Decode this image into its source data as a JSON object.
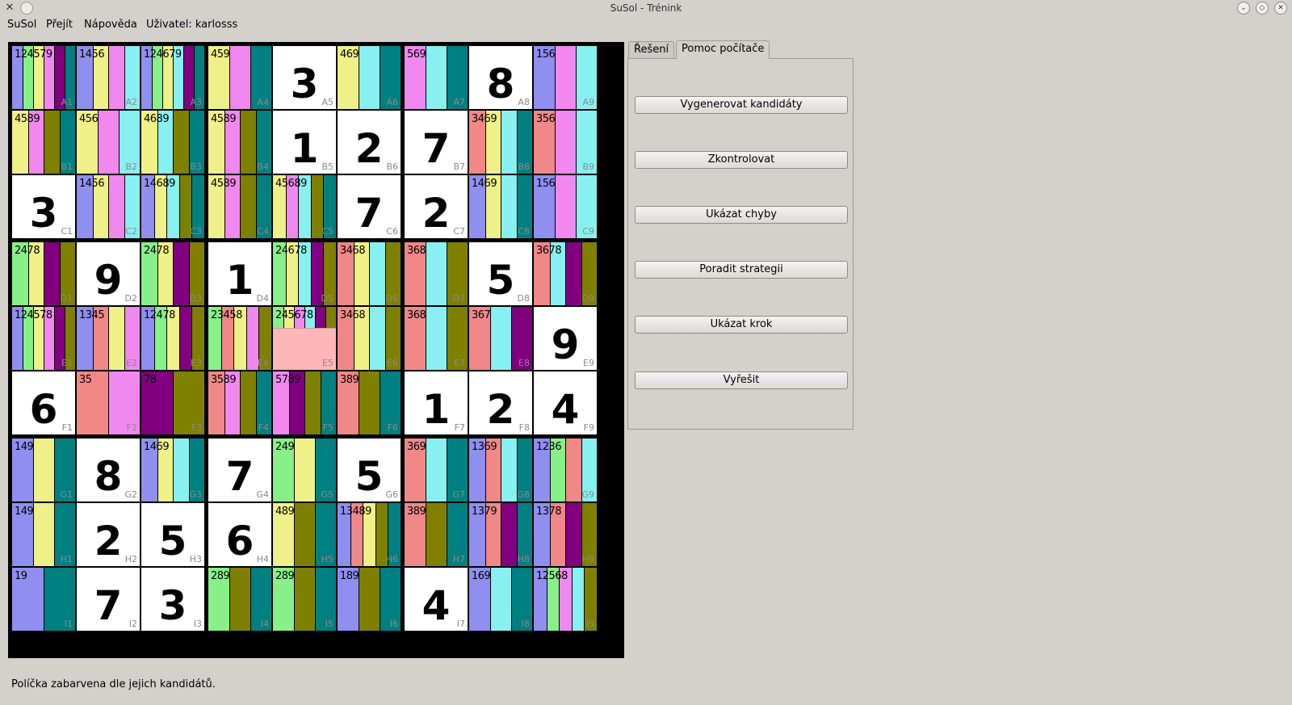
{
  "window": {
    "title": "SuSol - Trénink"
  },
  "menu": [
    "SuSol",
    "Přejít",
    "Nápověda",
    "Uživatel: karlosss"
  ],
  "tabs": [
    "Řešení",
    "Pomoc počítače"
  ],
  "buttons": [
    "Vygenerovat kandidáty",
    "Zkontrolovat",
    "Ukázat chyby",
    "Poradit strategii",
    "Ukázat krok",
    "Vyřešit"
  ],
  "status": "Políčka zabarvena dle jejich kandidátů.",
  "candidate_colors": {
    "1": "#8f8ff0",
    "2": "#88f088",
    "3": "#f08888",
    "4": "#f0f088",
    "5": "#f088f0",
    "6": "#88f0f0",
    "7": "#800080",
    "8": "#808000",
    "9": "#008080"
  },
  "rows": [
    "A",
    "B",
    "C",
    "D",
    "E",
    "F",
    "G",
    "H",
    "I"
  ],
  "grid": [
    [
      {
        "c": "124579"
      },
      {
        "c": "1456"
      },
      {
        "c": "124679"
      },
      {
        "c": "459"
      },
      {
        "v": "3"
      },
      {
        "c": "469"
      },
      {
        "c": "569"
      },
      {
        "v": "8"
      },
      {
        "c": "156"
      }
    ],
    [
      {
        "c": "4589"
      },
      {
        "c": "456"
      },
      {
        "c": "4689"
      },
      {
        "c": "4589"
      },
      {
        "v": "1"
      },
      {
        "v": "2"
      },
      {
        "v": "7"
      },
      {
        "c": "3469"
      },
      {
        "c": "356"
      }
    ],
    [
      {
        "v": "3"
      },
      {
        "c": "1456"
      },
      {
        "c": "14689"
      },
      {
        "c": "4589"
      },
      {
        "c": "45689"
      },
      {
        "v": "7"
      },
      {
        "v": "2"
      },
      {
        "c": "1469"
      },
      {
        "c": "156"
      }
    ],
    [
      {
        "c": "2478"
      },
      {
        "v": "9"
      },
      {
        "c": "2478"
      },
      {
        "v": "1"
      },
      {
        "c": "24678"
      },
      {
        "c": "3468"
      },
      {
        "c": "368"
      },
      {
        "v": "5"
      },
      {
        "c": "3678"
      }
    ],
    [
      {
        "c": "124578"
      },
      {
        "c": "1345"
      },
      {
        "c": "12478"
      },
      {
        "c": "23458"
      },
      {
        "c": "245678",
        "blank": true
      },
      {
        "c": "3468"
      },
      {
        "c": "368"
      },
      {
        "c": "367"
      },
      {
        "v": "9"
      }
    ],
    [
      {
        "v": "6"
      },
      {
        "c": "35"
      },
      {
        "c": "78"
      },
      {
        "c": "3589"
      },
      {
        "c": "5789"
      },
      {
        "c": "389"
      },
      {
        "v": "1"
      },
      {
        "v": "2"
      },
      {
        "v": "4"
      }
    ],
    [
      {
        "c": "149"
      },
      {
        "v": "8"
      },
      {
        "c": "1469"
      },
      {
        "v": "7"
      },
      {
        "c": "249"
      },
      {
        "v": "5"
      },
      {
        "c": "369"
      },
      {
        "c": "1369"
      },
      {
        "c": "1236"
      }
    ],
    [
      {
        "c": "149"
      },
      {
        "v": "2"
      },
      {
        "v": "5"
      },
      {
        "v": "6"
      },
      {
        "c": "489"
      },
      {
        "c": "13489"
      },
      {
        "c": "389"
      },
      {
        "c": "1379"
      },
      {
        "c": "1378"
      }
    ],
    [
      {
        "c": "19"
      },
      {
        "v": "7"
      },
      {
        "v": "3"
      },
      {
        "c": "289"
      },
      {
        "c": "289"
      },
      {
        "c": "189"
      },
      {
        "v": "4"
      },
      {
        "c": "169"
      },
      {
        "c": "12568"
      }
    ]
  ]
}
